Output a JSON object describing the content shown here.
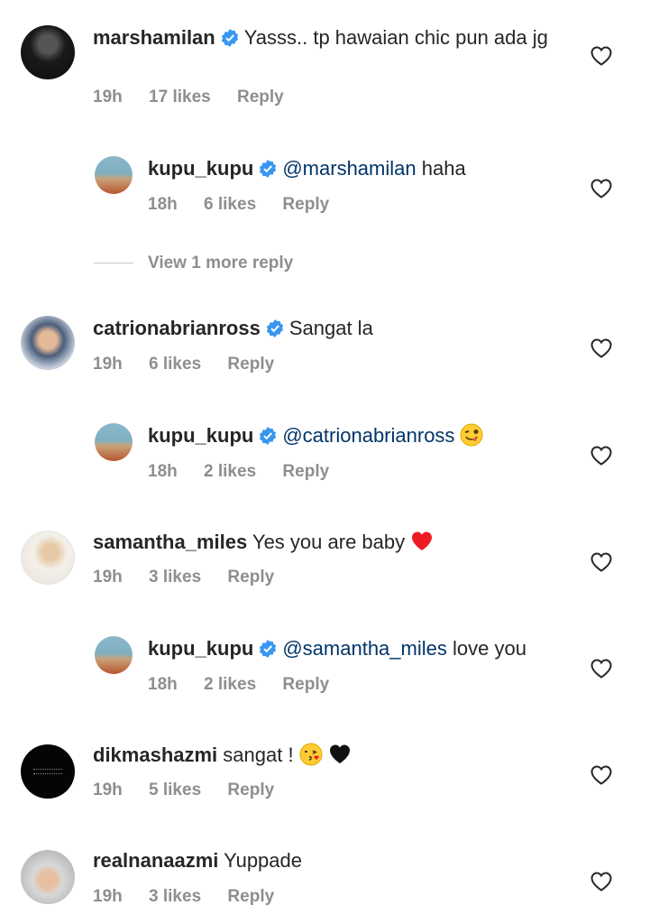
{
  "comments": [
    {
      "username": "marshamilan",
      "text": "Yasss.. tp hawaian chic pun ada jg",
      "time": "19h",
      "likes": "17 likes",
      "reply": "Reply"
    },
    {
      "username": "kupu_kupu",
      "mention": "@marshamilan",
      "text": "haha",
      "time": "18h",
      "likes": "6 likes",
      "reply": "Reply"
    },
    {
      "username": "catrionabrianross",
      "text": "Sangat la",
      "time": "19h",
      "likes": "6 likes",
      "reply": "Reply"
    },
    {
      "username": "kupu_kupu",
      "mention": "@catrionabrianross",
      "text": "",
      "time": "18h",
      "likes": "2 likes",
      "reply": "Reply"
    },
    {
      "username": "samantha_miles",
      "text": "Yes you are baby",
      "time": "19h",
      "likes": "3 likes",
      "reply": "Reply"
    },
    {
      "username": "kupu_kupu",
      "mention": "@samantha_miles",
      "text": "love you",
      "time": "18h",
      "likes": "2 likes",
      "reply": "Reply"
    },
    {
      "username": "dikmashazmi",
      "text": "sangat !",
      "time": "19h",
      "likes": "5 likes",
      "reply": "Reply"
    },
    {
      "username": "realnanaazmi",
      "text": "Yuppade",
      "time": "19h",
      "likes": "3 likes",
      "reply": "Reply"
    }
  ],
  "view_more": "View 1 more reply",
  "colors": {
    "verified": "#3897f0",
    "mention": "#003569",
    "meta": "#8e8e8e",
    "heart_emoji": "#ed1c24"
  }
}
